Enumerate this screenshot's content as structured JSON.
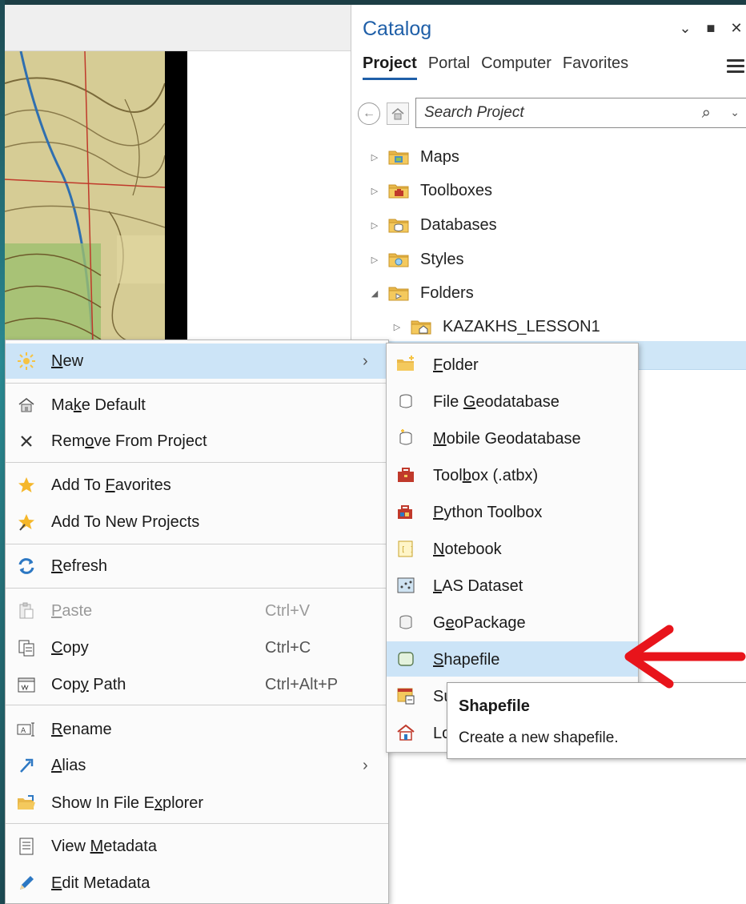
{
  "catalog": {
    "title": "Catalog",
    "tabs": [
      {
        "label": "Project",
        "active": true
      },
      {
        "label": "Portal"
      },
      {
        "label": "Computer"
      },
      {
        "label": "Favorites"
      }
    ],
    "search": {
      "placeholder": "Search Project"
    },
    "tree": [
      {
        "label": "Maps",
        "expander": "collapsed",
        "icon": "maps-folder-icon"
      },
      {
        "label": "Toolboxes",
        "expander": "collapsed",
        "icon": "toolboxes-folder-icon"
      },
      {
        "label": "Databases",
        "expander": "collapsed",
        "icon": "databases-folder-icon"
      },
      {
        "label": "Styles",
        "expander": "collapsed",
        "icon": "styles-folder-icon"
      },
      {
        "label": "Folders",
        "expander": "expanded",
        "icon": "folders-folder-icon"
      },
      {
        "label": "KAZAKHS_LESSON1",
        "expander": "collapsed",
        "icon": "home-folder-icon"
      }
    ]
  },
  "context_menu": {
    "items": [
      {
        "pre": "",
        "key": "N",
        "post": "ew",
        "icon": "new-sun-icon",
        "arrow": true,
        "highlighted": true
      },
      {
        "pre": "Ma",
        "key": "k",
        "post": "e Default",
        "icon": "home-icon"
      },
      {
        "pre": "Rem",
        "key": "o",
        "post": "ve From Project",
        "icon": "remove-x-icon"
      },
      {
        "pre": "Add To ",
        "key": "F",
        "post": "avorites",
        "icon": "star-icon"
      },
      {
        "pre": "Add To New Pro",
        "key": "j",
        "post": "ects",
        "icon": "star-pin-icon"
      },
      {
        "pre": "",
        "key": "R",
        "post": "efresh",
        "icon": "refresh-icon"
      },
      {
        "pre": "",
        "key": "P",
        "post": "aste",
        "icon": "paste-icon",
        "shortcut": "Ctrl+V",
        "disabled": true
      },
      {
        "pre": "",
        "key": "C",
        "post": "opy",
        "icon": "copy-icon",
        "shortcut": "Ctrl+C"
      },
      {
        "pre": "Cop",
        "key": "y",
        "post": " Path",
        "icon": "copy-path-icon",
        "shortcut": "Ctrl+Alt+P"
      },
      {
        "pre": "",
        "key": "R",
        "post": "ename",
        "icon": "rename-icon"
      },
      {
        "pre": "",
        "key": "A",
        "post": "lias",
        "icon": "alias-arrow-icon",
        "arrow": true
      },
      {
        "pre": "Show In File E",
        "key": "x",
        "post": "plorer",
        "icon": "open-folder-icon"
      },
      {
        "pre": "View ",
        "key": "M",
        "post": "etadata",
        "icon": "view-metadata-icon"
      },
      {
        "pre": "",
        "key": "E",
        "post": "dit Metadata",
        "icon": "edit-pencil-icon"
      }
    ]
  },
  "submenu": {
    "items": [
      {
        "pre": "",
        "key": "F",
        "post": "older",
        "icon": "new-folder-icon"
      },
      {
        "pre": "File ",
        "key": "G",
        "post": "eodatabase",
        "icon": "file-geodatabase-icon"
      },
      {
        "pre": "",
        "key": "M",
        "post": "obile Geodatabase",
        "icon": "mobile-geodatabase-icon"
      },
      {
        "pre": "Tool",
        "key": "b",
        "post": "ox (.atbx)",
        "icon": "toolbox-icon"
      },
      {
        "pre": "",
        "key": "P",
        "post": "ython Toolbox",
        "icon": "python-toolbox-icon"
      },
      {
        "pre": "",
        "key": "N",
        "post": "otebook",
        "icon": "notebook-icon"
      },
      {
        "pre": "",
        "key": "L",
        "post": "AS Dataset",
        "icon": "las-dataset-icon"
      },
      {
        "pre": "G",
        "key": "e",
        "post": "oPackage",
        "icon": "geopackage-icon"
      },
      {
        "pre": "",
        "key": "S",
        "post": "hapefile",
        "icon": "shapefile-icon",
        "highlighted": true
      },
      {
        "pre": "Su",
        "key": "",
        "post": "",
        "icon": "survey-icon"
      },
      {
        "pre": "Lo",
        "key": "",
        "post": "",
        "icon": "locator-icon"
      }
    ]
  },
  "tooltip": {
    "title": "Shapefile",
    "body": "Create a new shapefile."
  },
  "colors": {
    "accent": "#1f5fa8",
    "highlight": "#cce4f7",
    "arrow": "#e8141b"
  }
}
